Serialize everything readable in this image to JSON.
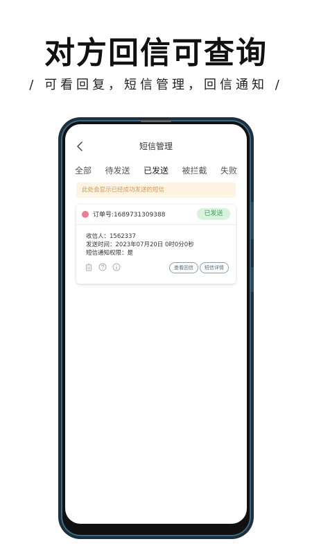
{
  "promo": {
    "headline": "对方回信可查询",
    "subline": "/ 可看回复，短信管理，回信通知 /"
  },
  "app": {
    "title": "短信管理",
    "tabs": [
      {
        "label": "全部",
        "active": false
      },
      {
        "label": "待发送",
        "active": false
      },
      {
        "label": "已发送",
        "active": true
      },
      {
        "label": "被拦截",
        "active": false
      },
      {
        "label": "失败",
        "active": false
      }
    ],
    "notice": "此处会显示已经成功发送的短信"
  },
  "order": {
    "order_no_label": "订单号:",
    "order_no": "1689731309388",
    "status": "已发送",
    "recipient_label": "收信人：",
    "recipient": "1562337",
    "send_time_label": "发送时间：",
    "send_time": "2023年07月20日 0时0分0秒",
    "notify_label": "短信通知权限：",
    "notify_value": "是",
    "view_reply_label": "查看回信",
    "detail_label": "短信详情"
  },
  "icons": {
    "back": "chevron-left-icon",
    "trash": "trash-icon",
    "help": "help-icon",
    "info": "info-icon"
  },
  "colors": {
    "accent": "#e0627a",
    "status_dot": "#e67f96",
    "badge_bg": "#d9f2de",
    "badge_text": "#3f9c55",
    "notice_bg": "#fdf3e3",
    "notice_text": "#d39a57",
    "phone_frame": "#1c2f3b"
  }
}
